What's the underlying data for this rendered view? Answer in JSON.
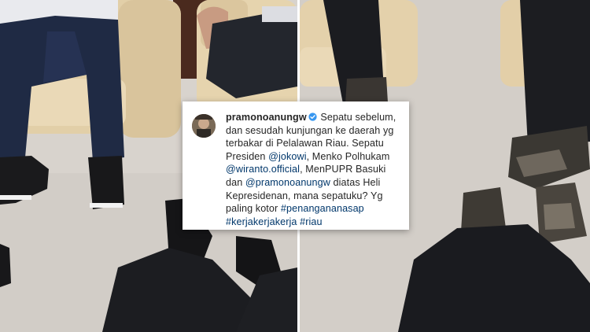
{
  "post": {
    "username": "pramonoanungw",
    "verified": true,
    "caption": {
      "segments": [
        {
          "text": "Sepatu sebelum, dan sesudah kunjungan ke daerah yg terbakar di Pelalawan Riau. Sepatu Presiden ",
          "type": "text"
        },
        {
          "text": "@jokowi",
          "type": "mention"
        },
        {
          "text": ", Menko Polhukam ",
          "type": "text"
        },
        {
          "text": "@wiranto.official",
          "type": "mention"
        },
        {
          "text": ", MenPUPR Basuki dan ",
          "type": "text"
        },
        {
          "text": "@pramonoanungw",
          "type": "mention"
        },
        {
          "text": " diatas Heli Kepresidenan, mana sepatuku? Yg paling kotor ",
          "type": "text"
        },
        {
          "text": "#penangananasap",
          "type": "hashtag"
        },
        {
          "text": " ",
          "type": "text"
        },
        {
          "text": "#kerjakerjakerja",
          "type": "hashtag"
        },
        {
          "text": " ",
          "type": "text"
        },
        {
          "text": "#riau",
          "type": "hashtag"
        }
      ]
    }
  },
  "icons": {
    "verified": "verified-badge-icon",
    "avatar": "profile-avatar"
  },
  "colors": {
    "text": "#262626",
    "link": "#00376b",
    "verified": "#3897f0"
  }
}
